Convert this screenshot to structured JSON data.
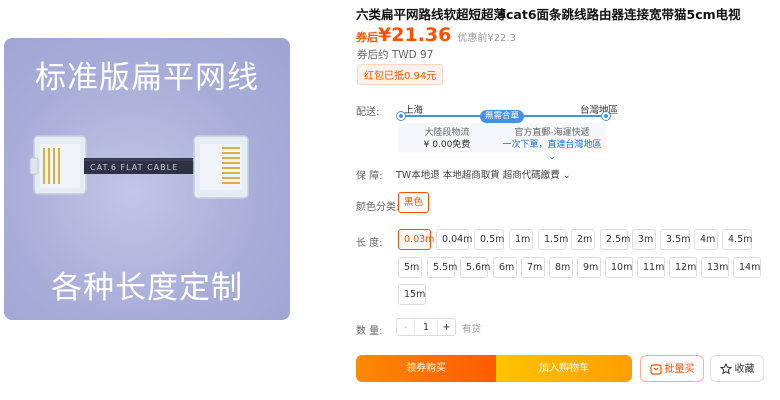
{
  "image": {
    "title_text": "标准版扁平网线",
    "subtitle_text": "各种长度定制",
    "cable_print": "CAT.6 FLAT CABLE"
  },
  "product": {
    "title": "六类扁平网路线软超短超薄cat6面条跳线路由器连接宽带猫5cm电视",
    "price_tag": "券后",
    "price": "¥21.36",
    "original_price": "优惠前¥22.3",
    "twd": "券后约 TWD 97",
    "red_badge": "红包已抵0.94元"
  },
  "shipping": {
    "label": "配送:",
    "from": "上海",
    "to": "台灣地區",
    "badge": "無需合單",
    "left_title": "大陸段物流",
    "left_value": "¥ 0.00免费",
    "right_title": "官方直郵-海運快遞",
    "right_value": "一次下單，直達台灣地區 ⌄"
  },
  "guarantee": {
    "label": "保    障:",
    "text": "TW本地退 本地超商取貨 超商代碼繳費 ⌄"
  },
  "color": {
    "label": "颜色分类:",
    "option": "黑色"
  },
  "length": {
    "label": "长    度:",
    "options": [
      "0.03m",
      "0.04m",
      "0.5m",
      "1m",
      "1.5m",
      "2m",
      "2.5m",
      "3m",
      "3.5m",
      "4m",
      "4.5m",
      "5m",
      "5.5m",
      "5.6m",
      "6m",
      "7m",
      "8m",
      "9m",
      "10m",
      "11m",
      "12m",
      "13m",
      "14m",
      "15m"
    ]
  },
  "quantity": {
    "label": "数    量:",
    "minus": "-",
    "value": "1",
    "plus": "+",
    "stock": "有货"
  },
  "buttons": {
    "buy": "领券购买",
    "cart": "加入购物车",
    "bulk": "批量买",
    "favorite": "收藏"
  },
  "colors": {
    "accent": "#ff5000",
    "route_blue": "#4a90e2"
  }
}
